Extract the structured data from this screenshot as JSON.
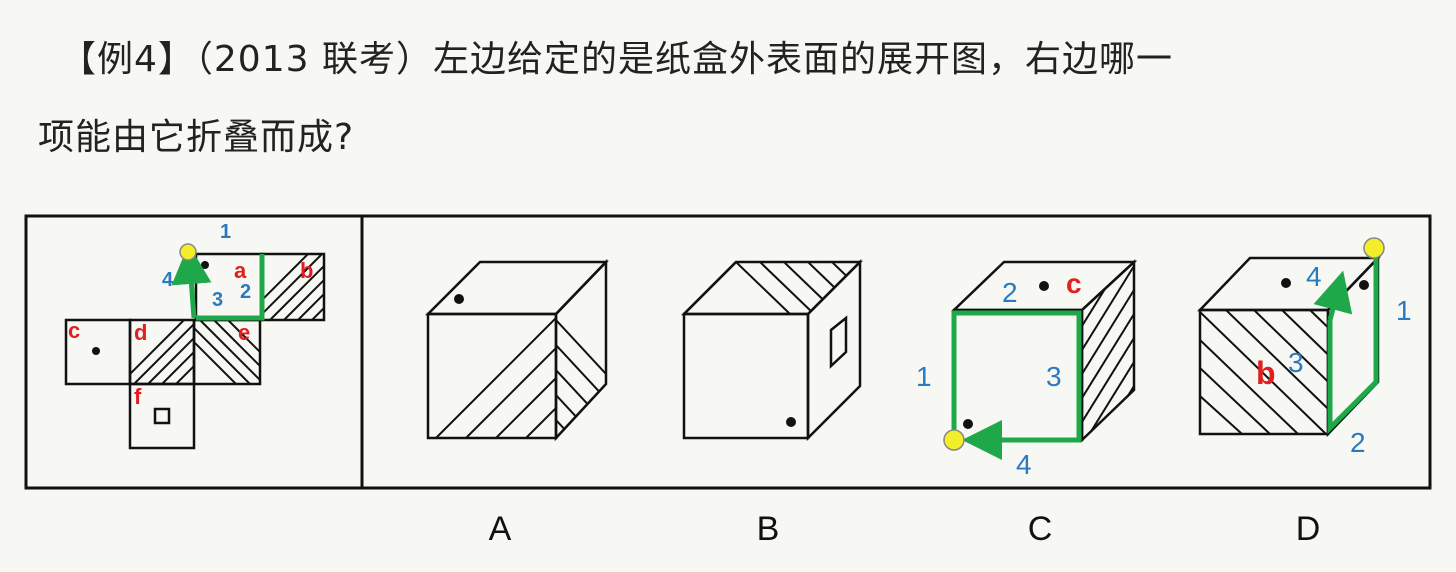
{
  "question": {
    "line1": "【例4】（2013 联考）左边给定的是纸盒外表面的展开图，右边哪一",
    "line2": "项能由它折叠而成?"
  },
  "net": {
    "face_labels": [
      "a",
      "b",
      "c",
      "d",
      "e",
      "f"
    ],
    "path_numbers": [
      "1",
      "2",
      "3",
      "4"
    ]
  },
  "options": [
    {
      "letter": "A"
    },
    {
      "letter": "B"
    },
    {
      "letter": "C",
      "face_labels": [
        "c"
      ],
      "path_numbers": [
        "1",
        "2",
        "3",
        "4"
      ]
    },
    {
      "letter": "D",
      "face_labels": [
        "b"
      ],
      "path_numbers": [
        "1",
        "2",
        "3",
        "4"
      ]
    }
  ],
  "colors": {
    "annotation_red": "#e02020",
    "annotation_blue": "#2a7ac0",
    "path_green": "#1fa84a",
    "marker_yellow": "#f2ee2a",
    "line": "#111111"
  }
}
